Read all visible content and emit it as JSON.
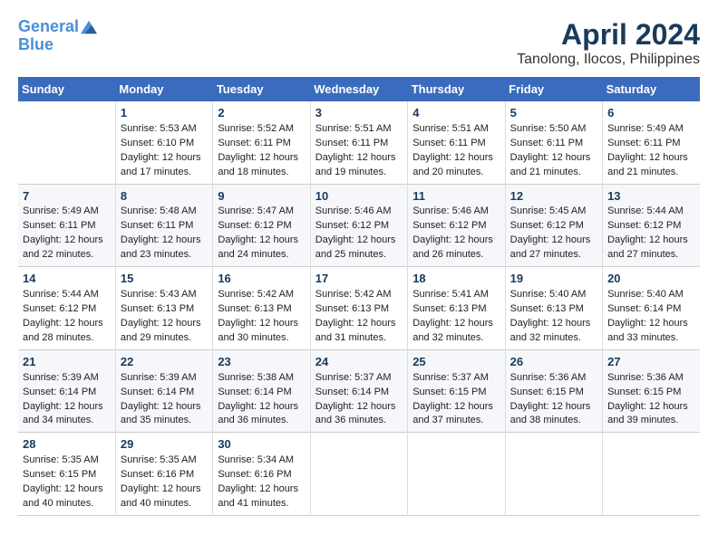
{
  "header": {
    "logo_line1": "General",
    "logo_line2": "Blue",
    "month": "April 2024",
    "location": "Tanolong, Ilocos, Philippines"
  },
  "weekdays": [
    "Sunday",
    "Monday",
    "Tuesday",
    "Wednesday",
    "Thursday",
    "Friday",
    "Saturday"
  ],
  "weeks": [
    [
      {
        "day": "",
        "sunrise": "",
        "sunset": "",
        "daylight": ""
      },
      {
        "day": "1",
        "sunrise": "Sunrise: 5:53 AM",
        "sunset": "Sunset: 6:10 PM",
        "daylight": "Daylight: 12 hours and 17 minutes."
      },
      {
        "day": "2",
        "sunrise": "Sunrise: 5:52 AM",
        "sunset": "Sunset: 6:11 PM",
        "daylight": "Daylight: 12 hours and 18 minutes."
      },
      {
        "day": "3",
        "sunrise": "Sunrise: 5:51 AM",
        "sunset": "Sunset: 6:11 PM",
        "daylight": "Daylight: 12 hours and 19 minutes."
      },
      {
        "day": "4",
        "sunrise": "Sunrise: 5:51 AM",
        "sunset": "Sunset: 6:11 PM",
        "daylight": "Daylight: 12 hours and 20 minutes."
      },
      {
        "day": "5",
        "sunrise": "Sunrise: 5:50 AM",
        "sunset": "Sunset: 6:11 PM",
        "daylight": "Daylight: 12 hours and 21 minutes."
      },
      {
        "day": "6",
        "sunrise": "Sunrise: 5:49 AM",
        "sunset": "Sunset: 6:11 PM",
        "daylight": "Daylight: 12 hours and 21 minutes."
      }
    ],
    [
      {
        "day": "7",
        "sunrise": "Sunrise: 5:49 AM",
        "sunset": "Sunset: 6:11 PM",
        "daylight": "Daylight: 12 hours and 22 minutes."
      },
      {
        "day": "8",
        "sunrise": "Sunrise: 5:48 AM",
        "sunset": "Sunset: 6:11 PM",
        "daylight": "Daylight: 12 hours and 23 minutes."
      },
      {
        "day": "9",
        "sunrise": "Sunrise: 5:47 AM",
        "sunset": "Sunset: 6:12 PM",
        "daylight": "Daylight: 12 hours and 24 minutes."
      },
      {
        "day": "10",
        "sunrise": "Sunrise: 5:46 AM",
        "sunset": "Sunset: 6:12 PM",
        "daylight": "Daylight: 12 hours and 25 minutes."
      },
      {
        "day": "11",
        "sunrise": "Sunrise: 5:46 AM",
        "sunset": "Sunset: 6:12 PM",
        "daylight": "Daylight: 12 hours and 26 minutes."
      },
      {
        "day": "12",
        "sunrise": "Sunrise: 5:45 AM",
        "sunset": "Sunset: 6:12 PM",
        "daylight": "Daylight: 12 hours and 27 minutes."
      },
      {
        "day": "13",
        "sunrise": "Sunrise: 5:44 AM",
        "sunset": "Sunset: 6:12 PM",
        "daylight": "Daylight: 12 hours and 27 minutes."
      }
    ],
    [
      {
        "day": "14",
        "sunrise": "Sunrise: 5:44 AM",
        "sunset": "Sunset: 6:12 PM",
        "daylight": "Daylight: 12 hours and 28 minutes."
      },
      {
        "day": "15",
        "sunrise": "Sunrise: 5:43 AM",
        "sunset": "Sunset: 6:13 PM",
        "daylight": "Daylight: 12 hours and 29 minutes."
      },
      {
        "day": "16",
        "sunrise": "Sunrise: 5:42 AM",
        "sunset": "Sunset: 6:13 PM",
        "daylight": "Daylight: 12 hours and 30 minutes."
      },
      {
        "day": "17",
        "sunrise": "Sunrise: 5:42 AM",
        "sunset": "Sunset: 6:13 PM",
        "daylight": "Daylight: 12 hours and 31 minutes."
      },
      {
        "day": "18",
        "sunrise": "Sunrise: 5:41 AM",
        "sunset": "Sunset: 6:13 PM",
        "daylight": "Daylight: 12 hours and 32 minutes."
      },
      {
        "day": "19",
        "sunrise": "Sunrise: 5:40 AM",
        "sunset": "Sunset: 6:13 PM",
        "daylight": "Daylight: 12 hours and 32 minutes."
      },
      {
        "day": "20",
        "sunrise": "Sunrise: 5:40 AM",
        "sunset": "Sunset: 6:14 PM",
        "daylight": "Daylight: 12 hours and 33 minutes."
      }
    ],
    [
      {
        "day": "21",
        "sunrise": "Sunrise: 5:39 AM",
        "sunset": "Sunset: 6:14 PM",
        "daylight": "Daylight: 12 hours and 34 minutes."
      },
      {
        "day": "22",
        "sunrise": "Sunrise: 5:39 AM",
        "sunset": "Sunset: 6:14 PM",
        "daylight": "Daylight: 12 hours and 35 minutes."
      },
      {
        "day": "23",
        "sunrise": "Sunrise: 5:38 AM",
        "sunset": "Sunset: 6:14 PM",
        "daylight": "Daylight: 12 hours and 36 minutes."
      },
      {
        "day": "24",
        "sunrise": "Sunrise: 5:37 AM",
        "sunset": "Sunset: 6:14 PM",
        "daylight": "Daylight: 12 hours and 36 minutes."
      },
      {
        "day": "25",
        "sunrise": "Sunrise: 5:37 AM",
        "sunset": "Sunset: 6:15 PM",
        "daylight": "Daylight: 12 hours and 37 minutes."
      },
      {
        "day": "26",
        "sunrise": "Sunrise: 5:36 AM",
        "sunset": "Sunset: 6:15 PM",
        "daylight": "Daylight: 12 hours and 38 minutes."
      },
      {
        "day": "27",
        "sunrise": "Sunrise: 5:36 AM",
        "sunset": "Sunset: 6:15 PM",
        "daylight": "Daylight: 12 hours and 39 minutes."
      }
    ],
    [
      {
        "day": "28",
        "sunrise": "Sunrise: 5:35 AM",
        "sunset": "Sunset: 6:15 PM",
        "daylight": "Daylight: 12 hours and 40 minutes."
      },
      {
        "day": "29",
        "sunrise": "Sunrise: 5:35 AM",
        "sunset": "Sunset: 6:16 PM",
        "daylight": "Daylight: 12 hours and 40 minutes."
      },
      {
        "day": "30",
        "sunrise": "Sunrise: 5:34 AM",
        "sunset": "Sunset: 6:16 PM",
        "daylight": "Daylight: 12 hours and 41 minutes."
      },
      {
        "day": "",
        "sunrise": "",
        "sunset": "",
        "daylight": ""
      },
      {
        "day": "",
        "sunrise": "",
        "sunset": "",
        "daylight": ""
      },
      {
        "day": "",
        "sunrise": "",
        "sunset": "",
        "daylight": ""
      },
      {
        "day": "",
        "sunrise": "",
        "sunset": "",
        "daylight": ""
      }
    ]
  ]
}
